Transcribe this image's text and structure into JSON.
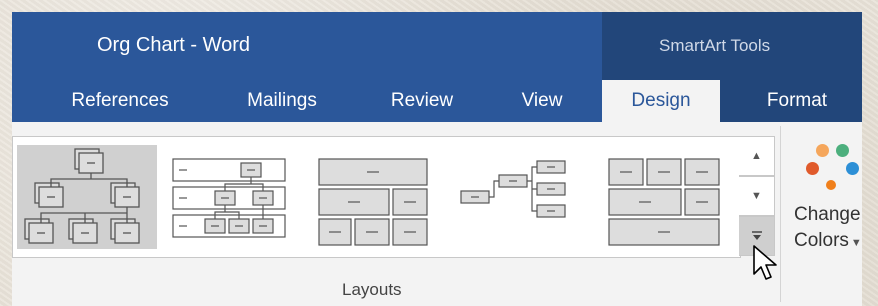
{
  "window": {
    "title": "Org Chart - Word",
    "contextual_tools_label": "SmartArt Tools"
  },
  "tabs": [
    {
      "label": "References",
      "active": false
    },
    {
      "label": "Mailings",
      "active": false
    },
    {
      "label": "Review",
      "active": false
    },
    {
      "label": "View",
      "active": false
    },
    {
      "label": "Design",
      "active": true
    },
    {
      "label": "Format",
      "active": false
    }
  ],
  "ribbon": {
    "layouts_group_label": "Layouts",
    "layouts_gallery": [
      {
        "icon": "org-chart-layout-icon",
        "selected": true
      },
      {
        "icon": "hierarchy-list-layout-icon",
        "selected": false
      },
      {
        "icon": "table-hierarchy-layout-icon",
        "selected": false
      },
      {
        "icon": "horizontal-hierarchy-layout-icon",
        "selected": false
      },
      {
        "icon": "stacked-grid-layout-icon",
        "selected": false
      }
    ],
    "gallery_scroll": {
      "up_icon": "scroll-up-icon",
      "down_icon": "scroll-down-icon",
      "more_icon": "more-layouts-icon"
    },
    "change_colors": {
      "line1": "Change",
      "line2": "Colors",
      "icon": "color-palette-icon",
      "dot_colors": [
        "#f5a65b",
        "#4caf7d",
        "#e05a2b",
        "#2c8fd6"
      ]
    }
  },
  "colors": {
    "title_bar": "#2b579a",
    "contextual_band": "#22467a",
    "ribbon_bg": "#f3f3f3"
  }
}
